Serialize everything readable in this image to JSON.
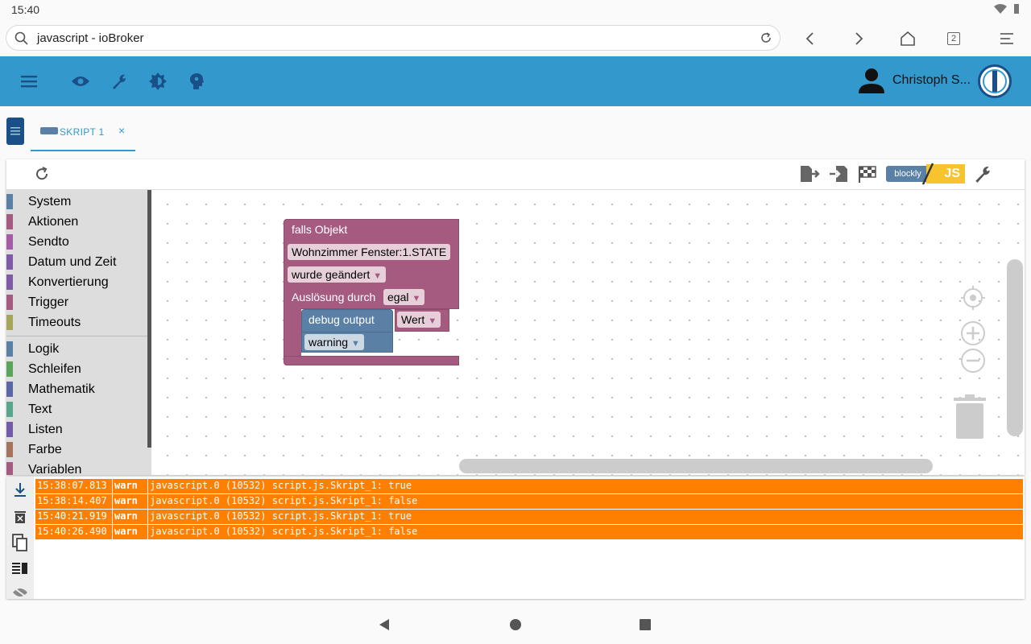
{
  "status_bar": {
    "time": "15:40"
  },
  "browser": {
    "url": "javascript - ioBroker",
    "tab_count": "2"
  },
  "app_bar": {
    "user_name": "Christoph S..."
  },
  "tabs": [
    {
      "label": "SKRIPT 1",
      "close": "×"
    }
  ],
  "toolbar": {
    "blockly_label": "blockly",
    "js_label": "JS"
  },
  "toolbox": {
    "group1": [
      {
        "label": "System",
        "color": "#5b80a5"
      },
      {
        "label": "Aktionen",
        "color": "#a55b80"
      },
      {
        "label": "Sendto",
        "color": "#a55ba5"
      },
      {
        "label": "Datum und Zeit",
        "color": "#805ba5"
      },
      {
        "label": "Konvertierung",
        "color": "#805ba5"
      },
      {
        "label": "Trigger",
        "color": "#a55b80"
      },
      {
        "label": "Timeouts",
        "color": "#a5a55b"
      }
    ],
    "group2": [
      {
        "label": "Logik",
        "color": "#5b80a5"
      },
      {
        "label": "Schleifen",
        "color": "#5ba55b"
      },
      {
        "label": "Mathematik",
        "color": "#5b67a5"
      },
      {
        "label": "Text",
        "color": "#5ba58c"
      },
      {
        "label": "Listen",
        "color": "#745ba5"
      },
      {
        "label": "Farbe",
        "color": "#a5745b"
      },
      {
        "label": "Variablen",
        "color": "#a55b80"
      }
    ]
  },
  "blocks": {
    "trigger_title": "falls Objekt",
    "object_id": "Wohnzimmer Fenster:1.STATE",
    "condition": "wurde geändert",
    "trigger_by_label": "Auslösung durch",
    "trigger_by_value": "egal",
    "debug_label": "debug output",
    "debug_value": "Wert",
    "log_level": "warning"
  },
  "log": [
    {
      "time": "15:38:07.813",
      "level": "warn",
      "message": "javascript.0 (10532) script.js.Skript_1: true"
    },
    {
      "time": "15:38:14.407",
      "level": "warn",
      "message": "javascript.0 (10532) script.js.Skript_1: false"
    },
    {
      "time": "15:40:21.919",
      "level": "warn",
      "message": "javascript.0 (10532) script.js.Skript_1: true"
    },
    {
      "time": "15:40:26.490",
      "level": "warn",
      "message": "javascript.0 (10532) script.js.Skript_1: false"
    }
  ]
}
